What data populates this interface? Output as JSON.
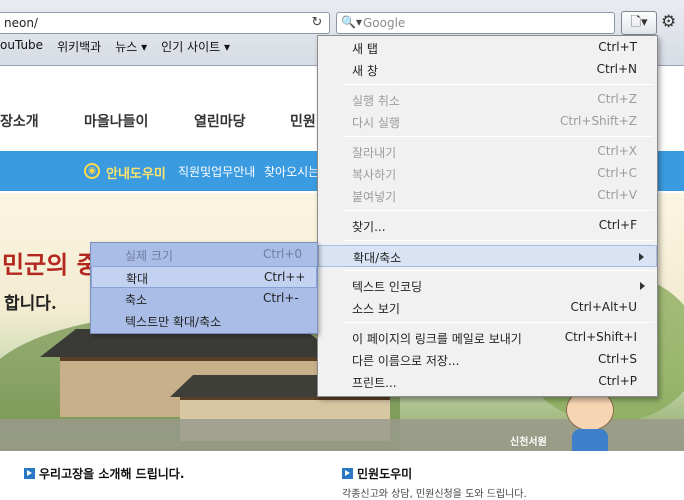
{
  "toolbar": {
    "url_text": "neon/",
    "search_placeholder": "Google",
    "reload_icon": "reload-icon",
    "page_icon": "page-menu-icon",
    "settings_icon": "gear-icon"
  },
  "bookmarks": [
    "ouTube",
    "위키백과",
    "뉴스 ▾",
    "인기 사이트 ▾"
  ],
  "page": {
    "nav": [
      "장소개",
      "마을나들이",
      "열린마당",
      "민원"
    ],
    "guide_title": "안내도우미",
    "guide_link_1": "직원및업무안내",
    "guide_link_2": "찾아오시는",
    "slogan_line1": "민군의 중심",
    "slogan_line2": "합니다.",
    "place_label": "신천서원",
    "bottom_left": "우리고장을 소개해 드립니다.",
    "bottom_right": "민원도우미",
    "bottom_right_sub": "각종신고와 상담, 민원신청을 도와 드립니다."
  },
  "menu": {
    "new_tab": {
      "label": "새 탭",
      "shortcut": "Ctrl+T"
    },
    "new_window": {
      "label": "새 창",
      "shortcut": "Ctrl+N"
    },
    "undo": {
      "label": "실행 취소",
      "shortcut": "Ctrl+Z"
    },
    "redo": {
      "label": "다시 실행",
      "shortcut": "Ctrl+Shift+Z"
    },
    "cut": {
      "label": "잘라내기",
      "shortcut": "Ctrl+X"
    },
    "copy": {
      "label": "복사하기",
      "shortcut": "Ctrl+C"
    },
    "paste": {
      "label": "붙여넣기",
      "shortcut": "Ctrl+V"
    },
    "find": {
      "label": "찾기...",
      "shortcut": "Ctrl+F"
    },
    "zoom": {
      "label": "확대/축소"
    },
    "encoding": {
      "label": "텍스트 인코딩"
    },
    "view_source": {
      "label": "소스 보기",
      "shortcut": "Ctrl+Alt+U"
    },
    "email_link": {
      "label": "이 페이지의 링크를 메일로 보내기",
      "shortcut": "Ctrl+Shift+I"
    },
    "save_as": {
      "label": "다른 이름으로 저장...",
      "shortcut": "Ctrl+S"
    },
    "print": {
      "label": "프린트...",
      "shortcut": "Ctrl+P"
    }
  },
  "submenu": {
    "actual_size": {
      "label": "실제 크기",
      "shortcut": "Ctrl+0"
    },
    "zoom_in": {
      "label": "확대",
      "shortcut": "Ctrl++"
    },
    "zoom_out": {
      "label": "축소",
      "shortcut": "Ctrl+-"
    },
    "text_only": {
      "label": "텍스트만 확대/축소"
    }
  }
}
